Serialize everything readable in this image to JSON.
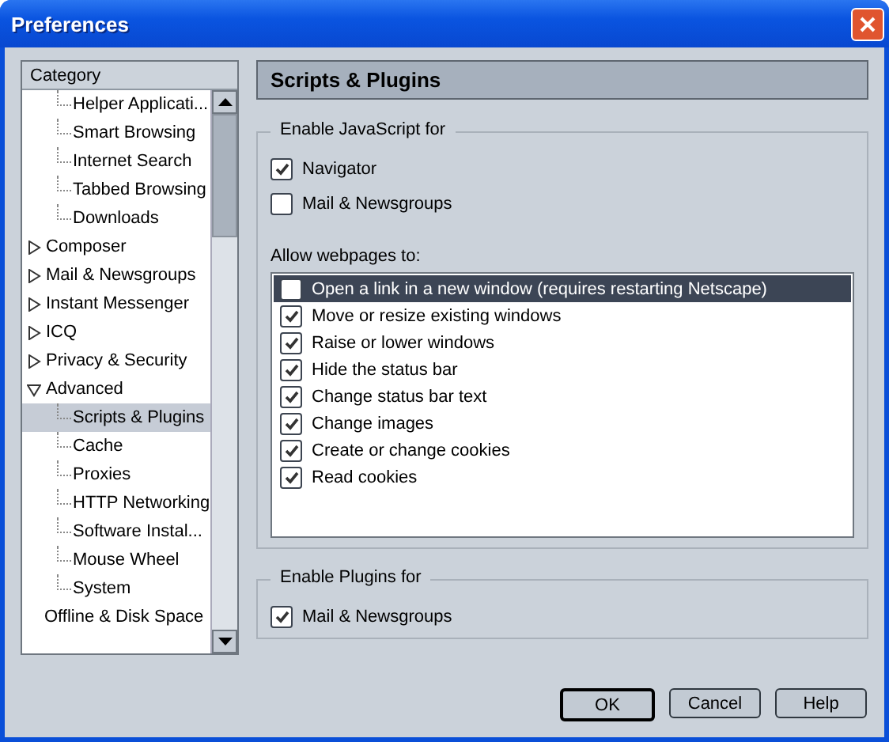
{
  "window": {
    "title": "Preferences"
  },
  "sidebar": {
    "header": "Category",
    "items": [
      {
        "children": [
          {
            "label": "Helper Applicati...",
            "selected": false
          },
          {
            "label": "Smart Browsing",
            "selected": false
          },
          {
            "label": "Internet Search",
            "selected": false
          },
          {
            "label": "Tabbed Browsing",
            "selected": false
          },
          {
            "label": "Downloads",
            "selected": false
          }
        ]
      },
      {
        "label": "Composer",
        "expanded": false,
        "selected": false
      },
      {
        "label": "Mail & Newsgroups",
        "expanded": false,
        "selected": false
      },
      {
        "label": "Instant Messenger",
        "expanded": false,
        "selected": false
      },
      {
        "label": "ICQ",
        "expanded": false,
        "selected": false
      },
      {
        "label": "Privacy & Security",
        "expanded": false,
        "selected": false
      },
      {
        "label": "Advanced",
        "expanded": true,
        "selected": false,
        "children": [
          {
            "label": "Scripts & Plugins",
            "selected": true
          },
          {
            "label": "Cache",
            "selected": false
          },
          {
            "label": "Proxies",
            "selected": false
          },
          {
            "label": "HTTP Networking",
            "selected": false
          },
          {
            "label": "Software Instal...",
            "selected": false
          },
          {
            "label": "Mouse Wheel",
            "selected": false
          },
          {
            "label": "System",
            "selected": false
          }
        ]
      },
      {
        "label": "Offline & Disk Space",
        "selected": false
      }
    ]
  },
  "panel": {
    "title": "Scripts & Plugins",
    "javascript": {
      "legend": "Enable JavaScript for",
      "options": [
        {
          "label": "Navigator",
          "checked": true
        },
        {
          "label": "Mail & Newsgroups",
          "checked": false
        }
      ],
      "allow_label": "Allow webpages to:",
      "allow": [
        {
          "label": "Open a link in a new window (requires restarting Netscape)",
          "checked": false,
          "selected": true
        },
        {
          "label": "Move or resize existing windows",
          "checked": true,
          "selected": false
        },
        {
          "label": "Raise or lower windows",
          "checked": true,
          "selected": false
        },
        {
          "label": "Hide the status bar",
          "checked": true,
          "selected": false
        },
        {
          "label": "Change status bar text",
          "checked": true,
          "selected": false
        },
        {
          "label": "Change images",
          "checked": true,
          "selected": false
        },
        {
          "label": "Create or change cookies",
          "checked": true,
          "selected": false
        },
        {
          "label": "Read cookies",
          "checked": true,
          "selected": false
        }
      ]
    },
    "plugins": {
      "legend": "Enable Plugins for",
      "options": [
        {
          "label": "Mail & Newsgroups",
          "checked": true
        }
      ]
    }
  },
  "buttons": [
    {
      "label": "OK",
      "default": true
    },
    {
      "label": "Cancel",
      "default": false
    },
    {
      "label": "Help",
      "default": false
    }
  ]
}
